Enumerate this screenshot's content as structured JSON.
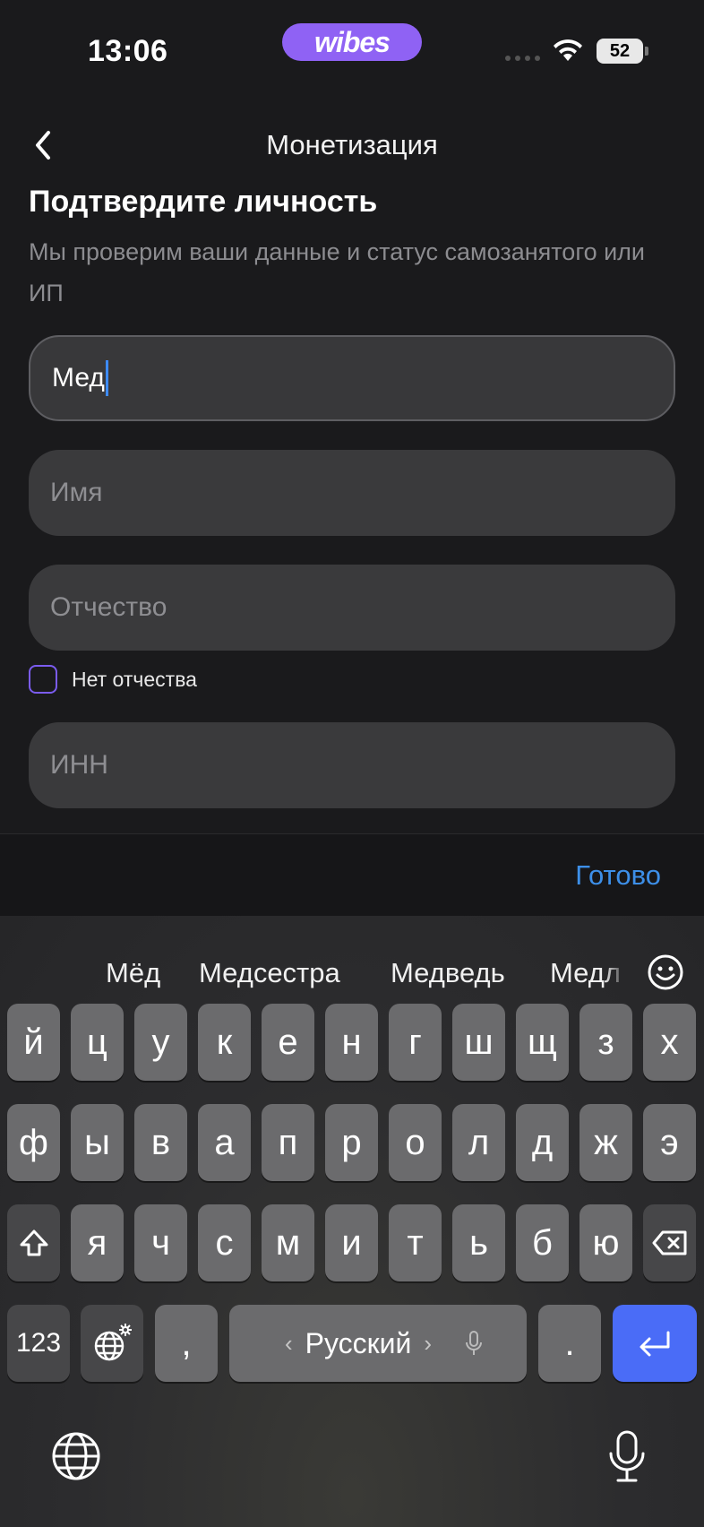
{
  "status_bar": {
    "time": "13:06",
    "brand": "wibes",
    "battery": "52"
  },
  "nav": {
    "title": "Монетизация"
  },
  "heading": "Подтвердите личность",
  "subtitle": "Мы проверим ваши данные и статус самозанятого или ИП",
  "form": {
    "surname_value": "Мед",
    "name_placeholder": "Имя",
    "patronymic_placeholder": "Отчество",
    "no_patronymic_label": "Нет отчества",
    "inn_placeholder": "ИНН"
  },
  "accessory": {
    "done_label": "Готово"
  },
  "keyboard": {
    "suggestions": [
      "Мёд",
      "Медсестра",
      "Медведь",
      "Медл"
    ],
    "row1": [
      "й",
      "ц",
      "у",
      "к",
      "е",
      "н",
      "г",
      "ш",
      "щ",
      "з",
      "х"
    ],
    "row2": [
      "ф",
      "ы",
      "в",
      "а",
      "п",
      "р",
      "о",
      "л",
      "д",
      "ж",
      "э"
    ],
    "row3": [
      "я",
      "ч",
      "с",
      "м",
      "и",
      "т",
      "ь",
      "б",
      "ю"
    ],
    "numbers_label": "123",
    "comma_label": ",",
    "space_label": "Русский",
    "space_left_arrow": "‹",
    "space_right_arrow": "›",
    "period_label": "."
  },
  "colors": {
    "accent_blue": "#4a6cf7",
    "brand_purple": "#8f62f4",
    "done_blue": "#3d8fe8"
  }
}
